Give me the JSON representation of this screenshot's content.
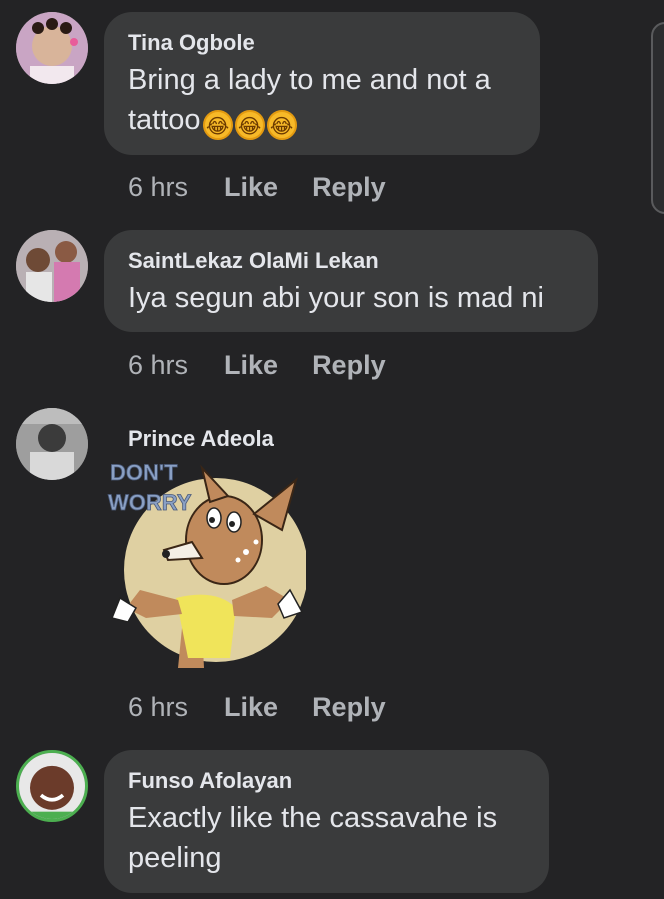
{
  "comments": [
    {
      "author": "Tina Ogbole",
      "text": "Bring a lady to me and not a tattoo",
      "emoji": "rolling-on-floor-laughing",
      "emoji_count": 3,
      "time": "6 hrs",
      "like_label": "Like",
      "reply_label": "Reply"
    },
    {
      "author": "SaintLekaz OlaMi Lekan",
      "text": "Iya segun abi your son is mad ni",
      "time": "6 hrs",
      "like_label": "Like",
      "reply_label": "Reply"
    },
    {
      "author": "Prince Adeola",
      "sticker_text": "DON'T WORRY",
      "time": "6 hrs",
      "like_label": "Like",
      "reply_label": "Reply"
    },
    {
      "author": "Funso Afolayan",
      "text": "Exactly like the cassavahe is peeling"
    }
  ],
  "colors": {
    "background": "#232325",
    "bubble": "#3a3b3c",
    "text": "#e4e6eb",
    "meta": "#b0b3b8"
  }
}
